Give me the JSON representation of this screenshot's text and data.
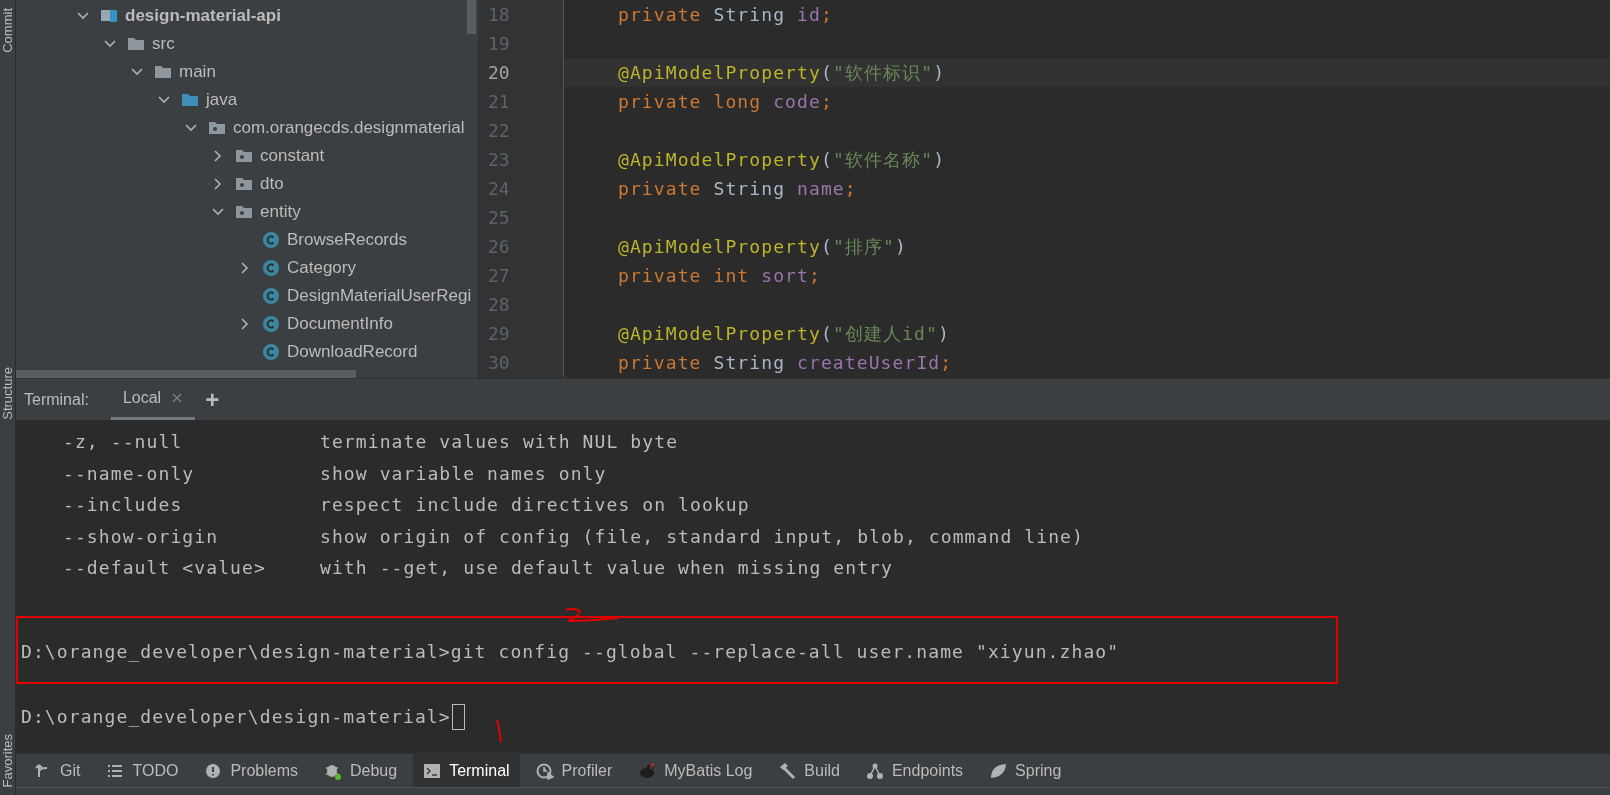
{
  "left_stripe": [
    {
      "label": "Commit"
    },
    {
      "label": "Structure"
    },
    {
      "label": "Favorites"
    }
  ],
  "project_tree": [
    {
      "label": "design-material-api",
      "kind": "module",
      "expanded": true,
      "children": [
        {
          "label": "src",
          "kind": "folder",
          "expanded": true,
          "children": [
            {
              "label": "main",
              "kind": "folder",
              "expanded": true,
              "children": [
                {
                  "label": "java",
                  "kind": "source-folder",
                  "expanded": true,
                  "children": [
                    {
                      "label": "com.orangecds.designmaterial",
                      "kind": "package",
                      "expanded": true,
                      "children": [
                        {
                          "label": "constant",
                          "kind": "package",
                          "expanded": false
                        },
                        {
                          "label": "dto",
                          "kind": "package",
                          "expanded": false
                        },
                        {
                          "label": "entity",
                          "kind": "package",
                          "expanded": true,
                          "children": [
                            {
                              "label": "BrowseRecords",
                              "kind": "class"
                            },
                            {
                              "label": "Category",
                              "kind": "class",
                              "expanded": false
                            },
                            {
                              "label": "DesignMaterialUserRegi",
                              "kind": "class"
                            },
                            {
                              "label": "DocumentInfo",
                              "kind": "class",
                              "expanded": false
                            },
                            {
                              "label": "DownloadRecord",
                              "kind": "class"
                            }
                          ]
                        }
                      ]
                    }
                  ]
                }
              ]
            }
          ]
        }
      ]
    }
  ],
  "editor": {
    "lines": [
      {
        "number": "18",
        "current": false,
        "tokens": [
          {
            "kind": "keyword",
            "text": "private "
          },
          {
            "kind": "plain",
            "text": "String "
          },
          {
            "kind": "field",
            "text": "id"
          },
          {
            "kind": "keyword",
            "text": ";"
          }
        ]
      },
      {
        "number": "19",
        "current": false
      },
      {
        "number": "20",
        "current": true,
        "tokens": [
          {
            "kind": "annotation",
            "text": "@ApiModelProperty"
          },
          {
            "kind": "plain",
            "text": "("
          },
          {
            "kind": "string",
            "text": "\"软件标识\""
          },
          {
            "kind": "plain",
            "text": ")"
          }
        ]
      },
      {
        "number": "21",
        "current": false,
        "tokens": [
          {
            "kind": "keyword",
            "text": "private long "
          },
          {
            "kind": "field",
            "text": "code"
          },
          {
            "kind": "keyword",
            "text": ";"
          }
        ]
      },
      {
        "number": "22",
        "current": false
      },
      {
        "number": "23",
        "current": false,
        "tokens": [
          {
            "kind": "annotation",
            "text": "@ApiModelProperty"
          },
          {
            "kind": "plain",
            "text": "("
          },
          {
            "kind": "string",
            "text": "\"软件名称\""
          },
          {
            "kind": "plain",
            "text": ")"
          }
        ]
      },
      {
        "number": "24",
        "current": false,
        "tokens": [
          {
            "kind": "keyword",
            "text": "private "
          },
          {
            "kind": "plain",
            "text": "String "
          },
          {
            "kind": "field",
            "text": "name"
          },
          {
            "kind": "keyword",
            "text": ";"
          }
        ]
      },
      {
        "number": "25",
        "current": false
      },
      {
        "number": "26",
        "current": false,
        "tokens": [
          {
            "kind": "annotation",
            "text": "@ApiModelProperty"
          },
          {
            "kind": "plain",
            "text": "("
          },
          {
            "kind": "string",
            "text": "\"排序\""
          },
          {
            "kind": "plain",
            "text": ")"
          }
        ]
      },
      {
        "number": "27",
        "current": false,
        "tokens": [
          {
            "kind": "keyword",
            "text": "private int "
          },
          {
            "kind": "field",
            "text": "sort"
          },
          {
            "kind": "keyword",
            "text": ";"
          }
        ]
      },
      {
        "number": "28",
        "current": false
      },
      {
        "number": "29",
        "current": false,
        "tokens": [
          {
            "kind": "annotation",
            "text": "@ApiModelProperty"
          },
          {
            "kind": "plain",
            "text": "("
          },
          {
            "kind": "string",
            "text": "\"创建人id\""
          },
          {
            "kind": "plain",
            "text": ")"
          }
        ]
      },
      {
        "number": "30",
        "current": false,
        "tokens": [
          {
            "kind": "keyword",
            "text": "private "
          },
          {
            "kind": "plain",
            "text": "String "
          },
          {
            "kind": "field",
            "text": "createUserId"
          },
          {
            "kind": "keyword",
            "text": ";"
          }
        ]
      }
    ]
  },
  "terminal": {
    "title": "Terminal:",
    "tabs": [
      {
        "label": "Local",
        "selected": true
      }
    ],
    "add_button": "+",
    "options": [
      {
        "flag": "-z, --null",
        "description": "terminate values with NUL byte"
      },
      {
        "flag": "--name-only",
        "description": "show variable names only"
      },
      {
        "flag": "--includes",
        "description": "respect include directives on lookup"
      },
      {
        "flag": "--show-origin",
        "description": "show origin of config (file, standard input, blob, command line)"
      },
      {
        "flag": "--default <value>",
        "description": "with --get, use default value when missing entry"
      }
    ],
    "command": "D:\\orange_developer\\design-material>git config --global --replace-all user.name \"xiyun.zhao\"",
    "prompt": "D:\\orange_developer\\design-material>"
  },
  "tool_windows": [
    {
      "label": "Git",
      "kind": "git",
      "selected": false
    },
    {
      "label": "TODO",
      "kind": "list",
      "selected": false
    },
    {
      "label": "Problems",
      "kind": "problems",
      "selected": false
    },
    {
      "label": "Debug",
      "kind": "bug",
      "selected": false
    },
    {
      "label": "Terminal",
      "kind": "terminal",
      "selected": true
    },
    {
      "label": "Profiler",
      "kind": "profiler",
      "selected": false
    },
    {
      "label": "MyBatis Log",
      "kind": "bird",
      "selected": false
    },
    {
      "label": "Build",
      "kind": "hammer",
      "selected": false
    },
    {
      "label": "Endpoints",
      "kind": "endpoints",
      "selected": false
    },
    {
      "label": "Spring",
      "kind": "leaf",
      "selected": false
    }
  ]
}
